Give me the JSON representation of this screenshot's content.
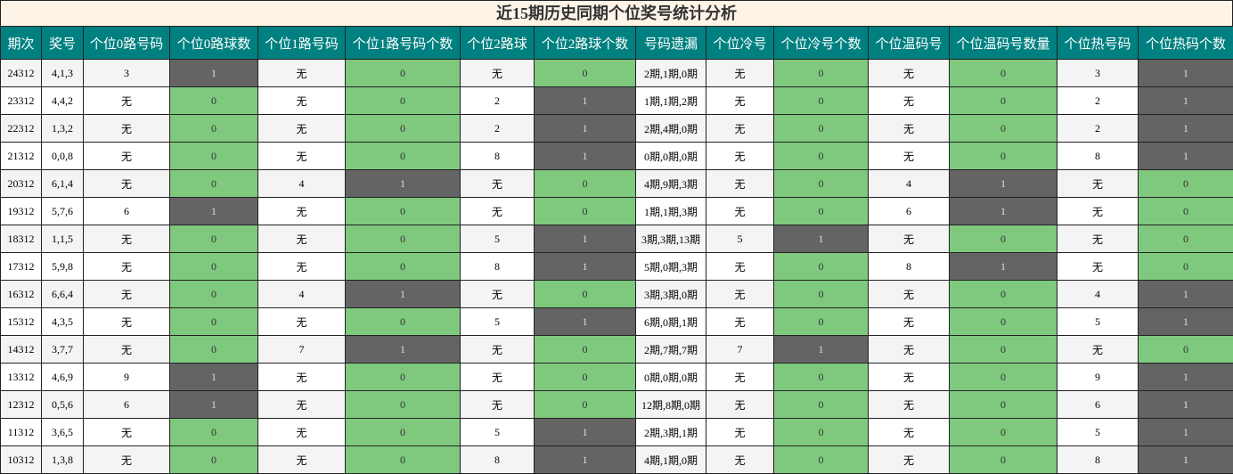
{
  "title": "近15期历史同期个位奖号统计分析",
  "colors": {
    "header_bg": "#008080",
    "zero_cell": "#7fc97f",
    "one_cell": "#646464",
    "title_bg": "#fdf3e6"
  },
  "headers": [
    "期次",
    "奖号",
    "个位0路号码",
    "个位0路球数",
    "个位1路号码",
    "个位1路号码个数",
    "个位2路球",
    "个位2路球个数",
    "号码遗漏",
    "个位冷号",
    "个位冷号个数",
    "个位温码号",
    "个位温码号数量",
    "个位热号码",
    "个位热码个数"
  ],
  "count_columns": [
    3,
    5,
    7,
    10,
    12,
    14
  ],
  "rows": [
    [
      "24312",
      "4,1,3",
      "3",
      "1",
      "无",
      "0",
      "无",
      "0",
      "2期,1期,0期",
      "无",
      "0",
      "无",
      "0",
      "3",
      "1"
    ],
    [
      "23312",
      "4,4,2",
      "无",
      "0",
      "无",
      "0",
      "2",
      "1",
      "1期,1期,2期",
      "无",
      "0",
      "无",
      "0",
      "2",
      "1"
    ],
    [
      "22312",
      "1,3,2",
      "无",
      "0",
      "无",
      "0",
      "2",
      "1",
      "2期,4期,0期",
      "无",
      "0",
      "无",
      "0",
      "2",
      "1"
    ],
    [
      "21312",
      "0,0,8",
      "无",
      "0",
      "无",
      "0",
      "8",
      "1",
      "0期,0期,0期",
      "无",
      "0",
      "无",
      "0",
      "8",
      "1"
    ],
    [
      "20312",
      "6,1,4",
      "无",
      "0",
      "4",
      "1",
      "无",
      "0",
      "4期,9期,3期",
      "无",
      "0",
      "4",
      "1",
      "无",
      "0"
    ],
    [
      "19312",
      "5,7,6",
      "6",
      "1",
      "无",
      "0",
      "无",
      "0",
      "1期,1期,3期",
      "无",
      "0",
      "6",
      "1",
      "无",
      "0"
    ],
    [
      "18312",
      "1,1,5",
      "无",
      "0",
      "无",
      "0",
      "5",
      "1",
      "3期,3期,13期",
      "5",
      "1",
      "无",
      "0",
      "无",
      "0"
    ],
    [
      "17312",
      "5,9,8",
      "无",
      "0",
      "无",
      "0",
      "8",
      "1",
      "5期,0期,3期",
      "无",
      "0",
      "8",
      "1",
      "无",
      "0"
    ],
    [
      "16312",
      "6,6,4",
      "无",
      "0",
      "4",
      "1",
      "无",
      "0",
      "3期,3期,0期",
      "无",
      "0",
      "无",
      "0",
      "4",
      "1"
    ],
    [
      "15312",
      "4,3,5",
      "无",
      "0",
      "无",
      "0",
      "5",
      "1",
      "6期,0期,1期",
      "无",
      "0",
      "无",
      "0",
      "5",
      "1"
    ],
    [
      "14312",
      "3,7,7",
      "无",
      "0",
      "7",
      "1",
      "无",
      "0",
      "2期,7期,7期",
      "7",
      "1",
      "无",
      "0",
      "无",
      "0"
    ],
    [
      "13312",
      "4,6,9",
      "9",
      "1",
      "无",
      "0",
      "无",
      "0",
      "0期,0期,0期",
      "无",
      "0",
      "无",
      "0",
      "9",
      "1"
    ],
    [
      "12312",
      "0,5,6",
      "6",
      "1",
      "无",
      "0",
      "无",
      "0",
      "12期,8期,0期",
      "无",
      "0",
      "无",
      "0",
      "6",
      "1"
    ],
    [
      "11312",
      "3,6,5",
      "无",
      "0",
      "无",
      "0",
      "5",
      "1",
      "2期,3期,1期",
      "无",
      "0",
      "无",
      "0",
      "5",
      "1"
    ],
    [
      "10312",
      "1,3,8",
      "无",
      "0",
      "无",
      "0",
      "8",
      "1",
      "4期,1期,0期",
      "无",
      "0",
      "无",
      "0",
      "8",
      "1"
    ]
  ]
}
